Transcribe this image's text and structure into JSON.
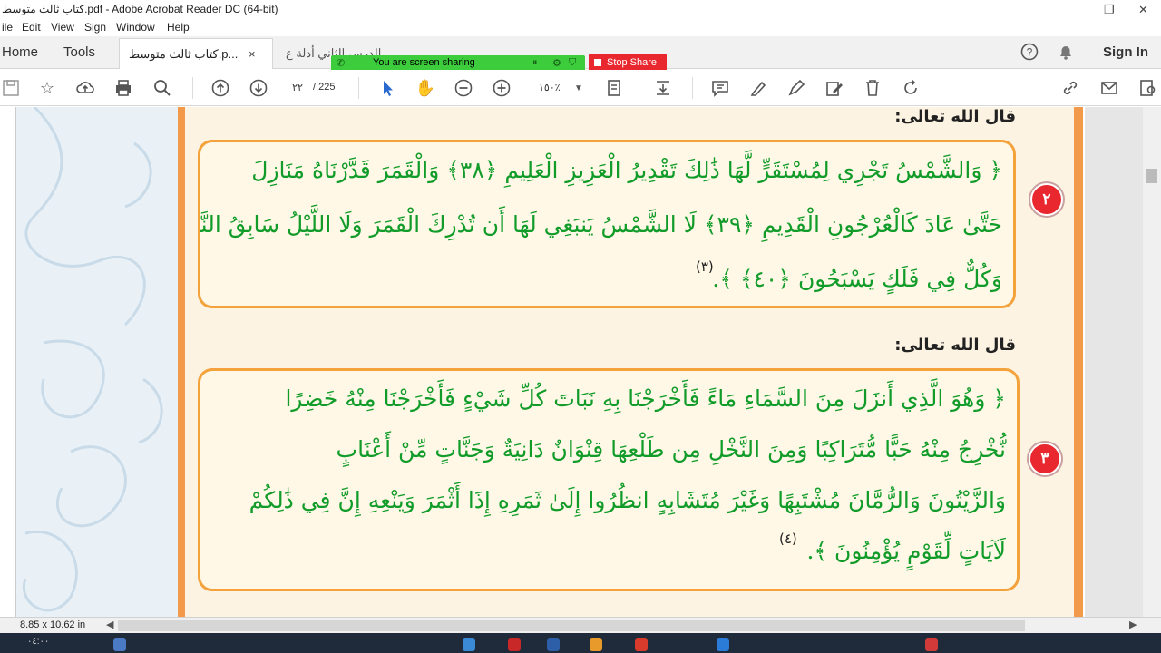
{
  "window": {
    "title": "كتاب ثالث متوسط.pdf - Adobe Acrobat Reader DC (64-bit)",
    "restore_icon": "restore-icon",
    "close_icon": "close-icon"
  },
  "menu": [
    "ile",
    "Edit",
    "View",
    "Sign",
    "Window",
    "Help"
  ],
  "tabs": {
    "home": "Home",
    "tools": "Tools",
    "doc_tabs": [
      {
        "label": "كتاب ثالث متوسط.p...",
        "active": true,
        "close": "×"
      },
      {
        "label": "الدرس الثاني أدلة ع...",
        "active": false,
        "close": ""
      }
    ],
    "sign_in": "Sign In"
  },
  "screen_share": {
    "label": "You are screen sharing",
    "stop_label": "Stop Share"
  },
  "toolbar": {
    "page_current": "٢٢",
    "page_total": "/ 225",
    "zoom": "١٥٠٪"
  },
  "document": {
    "sections": [
      {
        "heading": "قال الله تعالى:",
        "number": "٢",
        "lines": [
          "﴿ وَالشَّمْسُ تَجْرِي لِمُسْتَقَرٍّ لَّهَا ذَٰلِكَ تَقْدِيرُ الْعَزِيزِ الْعَلِيمِ ﴿٣٨﴾ وَالْقَمَرَ قَدَّرْنَاهُ مَنَازِلَ",
          "حَتَّىٰ عَادَ كَالْعُرْجُونِ الْقَدِيمِ ﴿٣٩﴾ لَا الشَّمْسُ يَنبَغِي لَهَا أَن تُدْرِكَ الْقَمَرَ وَلَا اللَّيْلُ سَابِقُ النَّهَارِ",
          "وَكُلٌّ فِي فَلَكٍ يَسْبَحُونَ ﴿٤٠﴾ ﴾."
        ],
        "footnote": "(٣)"
      },
      {
        "heading": "قال الله تعالى:",
        "number": "٣",
        "lines": [
          "﴿ وَهُوَ الَّذِي أَنزَلَ مِنَ السَّمَاءِ مَاءً فَأَخْرَجْنَا بِهِ نَبَاتَ كُلِّ شَيْءٍ فَأَخْرَجْنَا مِنْهُ خَضِرًا",
          "نُّخْرِجُ مِنْهُ حَبًّا مُّتَرَاكِبًا وَمِنَ النَّخْلِ مِن طَلْعِهَا قِنْوَانٌ دَانِيَةٌ وَجَنَّاتٍ مِّنْ أَعْنَابٍ",
          "وَالزَّيْتُونَ وَالرُّمَّانَ مُشْتَبِهًا وَغَيْرَ مُتَشَابِهٍ انظُرُوا إِلَىٰ ثَمَرِهِ إِذَا أَثْمَرَ وَيَنْعِهِ إِنَّ فِي ذَٰلِكُمْ",
          "لَآيَاتٍ لِّقَوْمٍ يُؤْمِنُونَ ﴾."
        ],
        "footnote": "(٤)"
      }
    ]
  },
  "status": {
    "page_size": "8.85 x 10.62 in"
  },
  "taskbar": {
    "clock": "٠٤:٠٠"
  }
}
